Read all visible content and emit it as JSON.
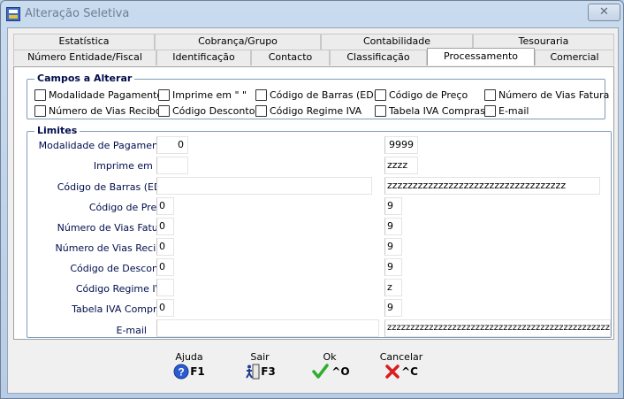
{
  "window": {
    "title": "Alteração Seletiva",
    "close_glyph": "✕"
  },
  "tabs": {
    "row1": [
      "Estatística",
      "Cobrança/Grupo",
      "Contabilidade",
      "Tesouraria"
    ],
    "row2": [
      "Número Entidade/Fiscal",
      "Identificação",
      "Contacto",
      "Classificação",
      "Processamento",
      "Comercial"
    ],
    "active": "Processamento"
  },
  "campos": {
    "legend": "Campos a Alterar",
    "items": [
      "Modalidade Pagamento",
      "Imprime em \"  \"",
      "Código de Barras (EDI)",
      "Código de Preço",
      "Número de Vias Fatura",
      "Número de Vias Recibo",
      "Código Desconto",
      "Código Regime IVA",
      "Tabela IVA Compras",
      "E-mail"
    ]
  },
  "limites": {
    "legend": "Limites",
    "rows": [
      {
        "label": "Modalidade de Pagamento",
        "from": "0",
        "to": "9999"
      },
      {
        "label": "Imprime em \"  \"",
        "from": "",
        "to": "zzzz"
      },
      {
        "label": "Código de Barras (EDI)",
        "from": "",
        "to": "zzzzzzzzzzzzzzzzzzzzzzzzzzzzzzzzzzz"
      },
      {
        "label": "Código de Preço",
        "from": "0",
        "to": "9"
      },
      {
        "label": "Número de Vias Fatura",
        "from": "0",
        "to": "9"
      },
      {
        "label": "Número de Vias Recibo",
        "from": "0",
        "to": "9"
      },
      {
        "label": "Código de Desconto",
        "from": "0",
        "to": "9"
      },
      {
        "label": "Código Regime IVA",
        "from": "",
        "to": "z"
      },
      {
        "label": "Tabela IVA Compras",
        "from": "0",
        "to": "9"
      },
      {
        "label": "E-mail",
        "from": "",
        "to": "zzzzzzzzzzzzzzzzzzzzzzzzzzzzzzzzzzzzzzzzzzzzzzzzzzzzzzzzzz"
      }
    ]
  },
  "buttons": {
    "ajuda": {
      "label": "Ajuda",
      "key": "F1"
    },
    "sair": {
      "label": "Sair",
      "key": "F3"
    },
    "ok": {
      "label": "Ok",
      "key": "^O"
    },
    "cancelar": {
      "label": "Cancelar",
      "key": "^C"
    }
  },
  "colors": {
    "label_text": "#000d4d",
    "ok_green": "#2fae2f",
    "cancel_red": "#d81e1e",
    "help_blue": "#2a5bd0"
  }
}
